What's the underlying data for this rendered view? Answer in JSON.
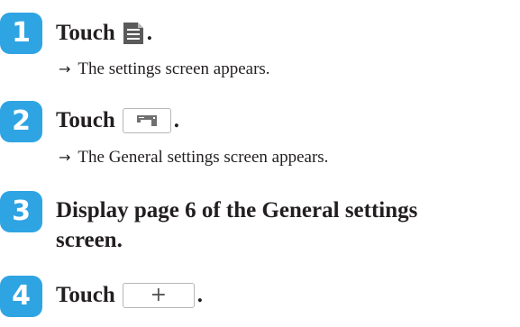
{
  "steps": [
    {
      "number": "1",
      "title": "Touch",
      "icon": "settings-document-icon",
      "end": ".",
      "result": "The settings screen appears."
    },
    {
      "number": "2",
      "title": "Touch",
      "icon": "sewing-machine-icon",
      "end": ".",
      "result": "The General settings screen appears."
    },
    {
      "number": "3",
      "title_line1": "Display page 6 of the General settings",
      "title_line2": "screen."
    },
    {
      "number": "4",
      "title": "Touch",
      "icon": "plus-icon",
      "button_label": "+",
      "end": "."
    }
  ],
  "result_arrow": "→",
  "colors": {
    "step_badge": "#2fa4e3",
    "text": "#231f20"
  }
}
